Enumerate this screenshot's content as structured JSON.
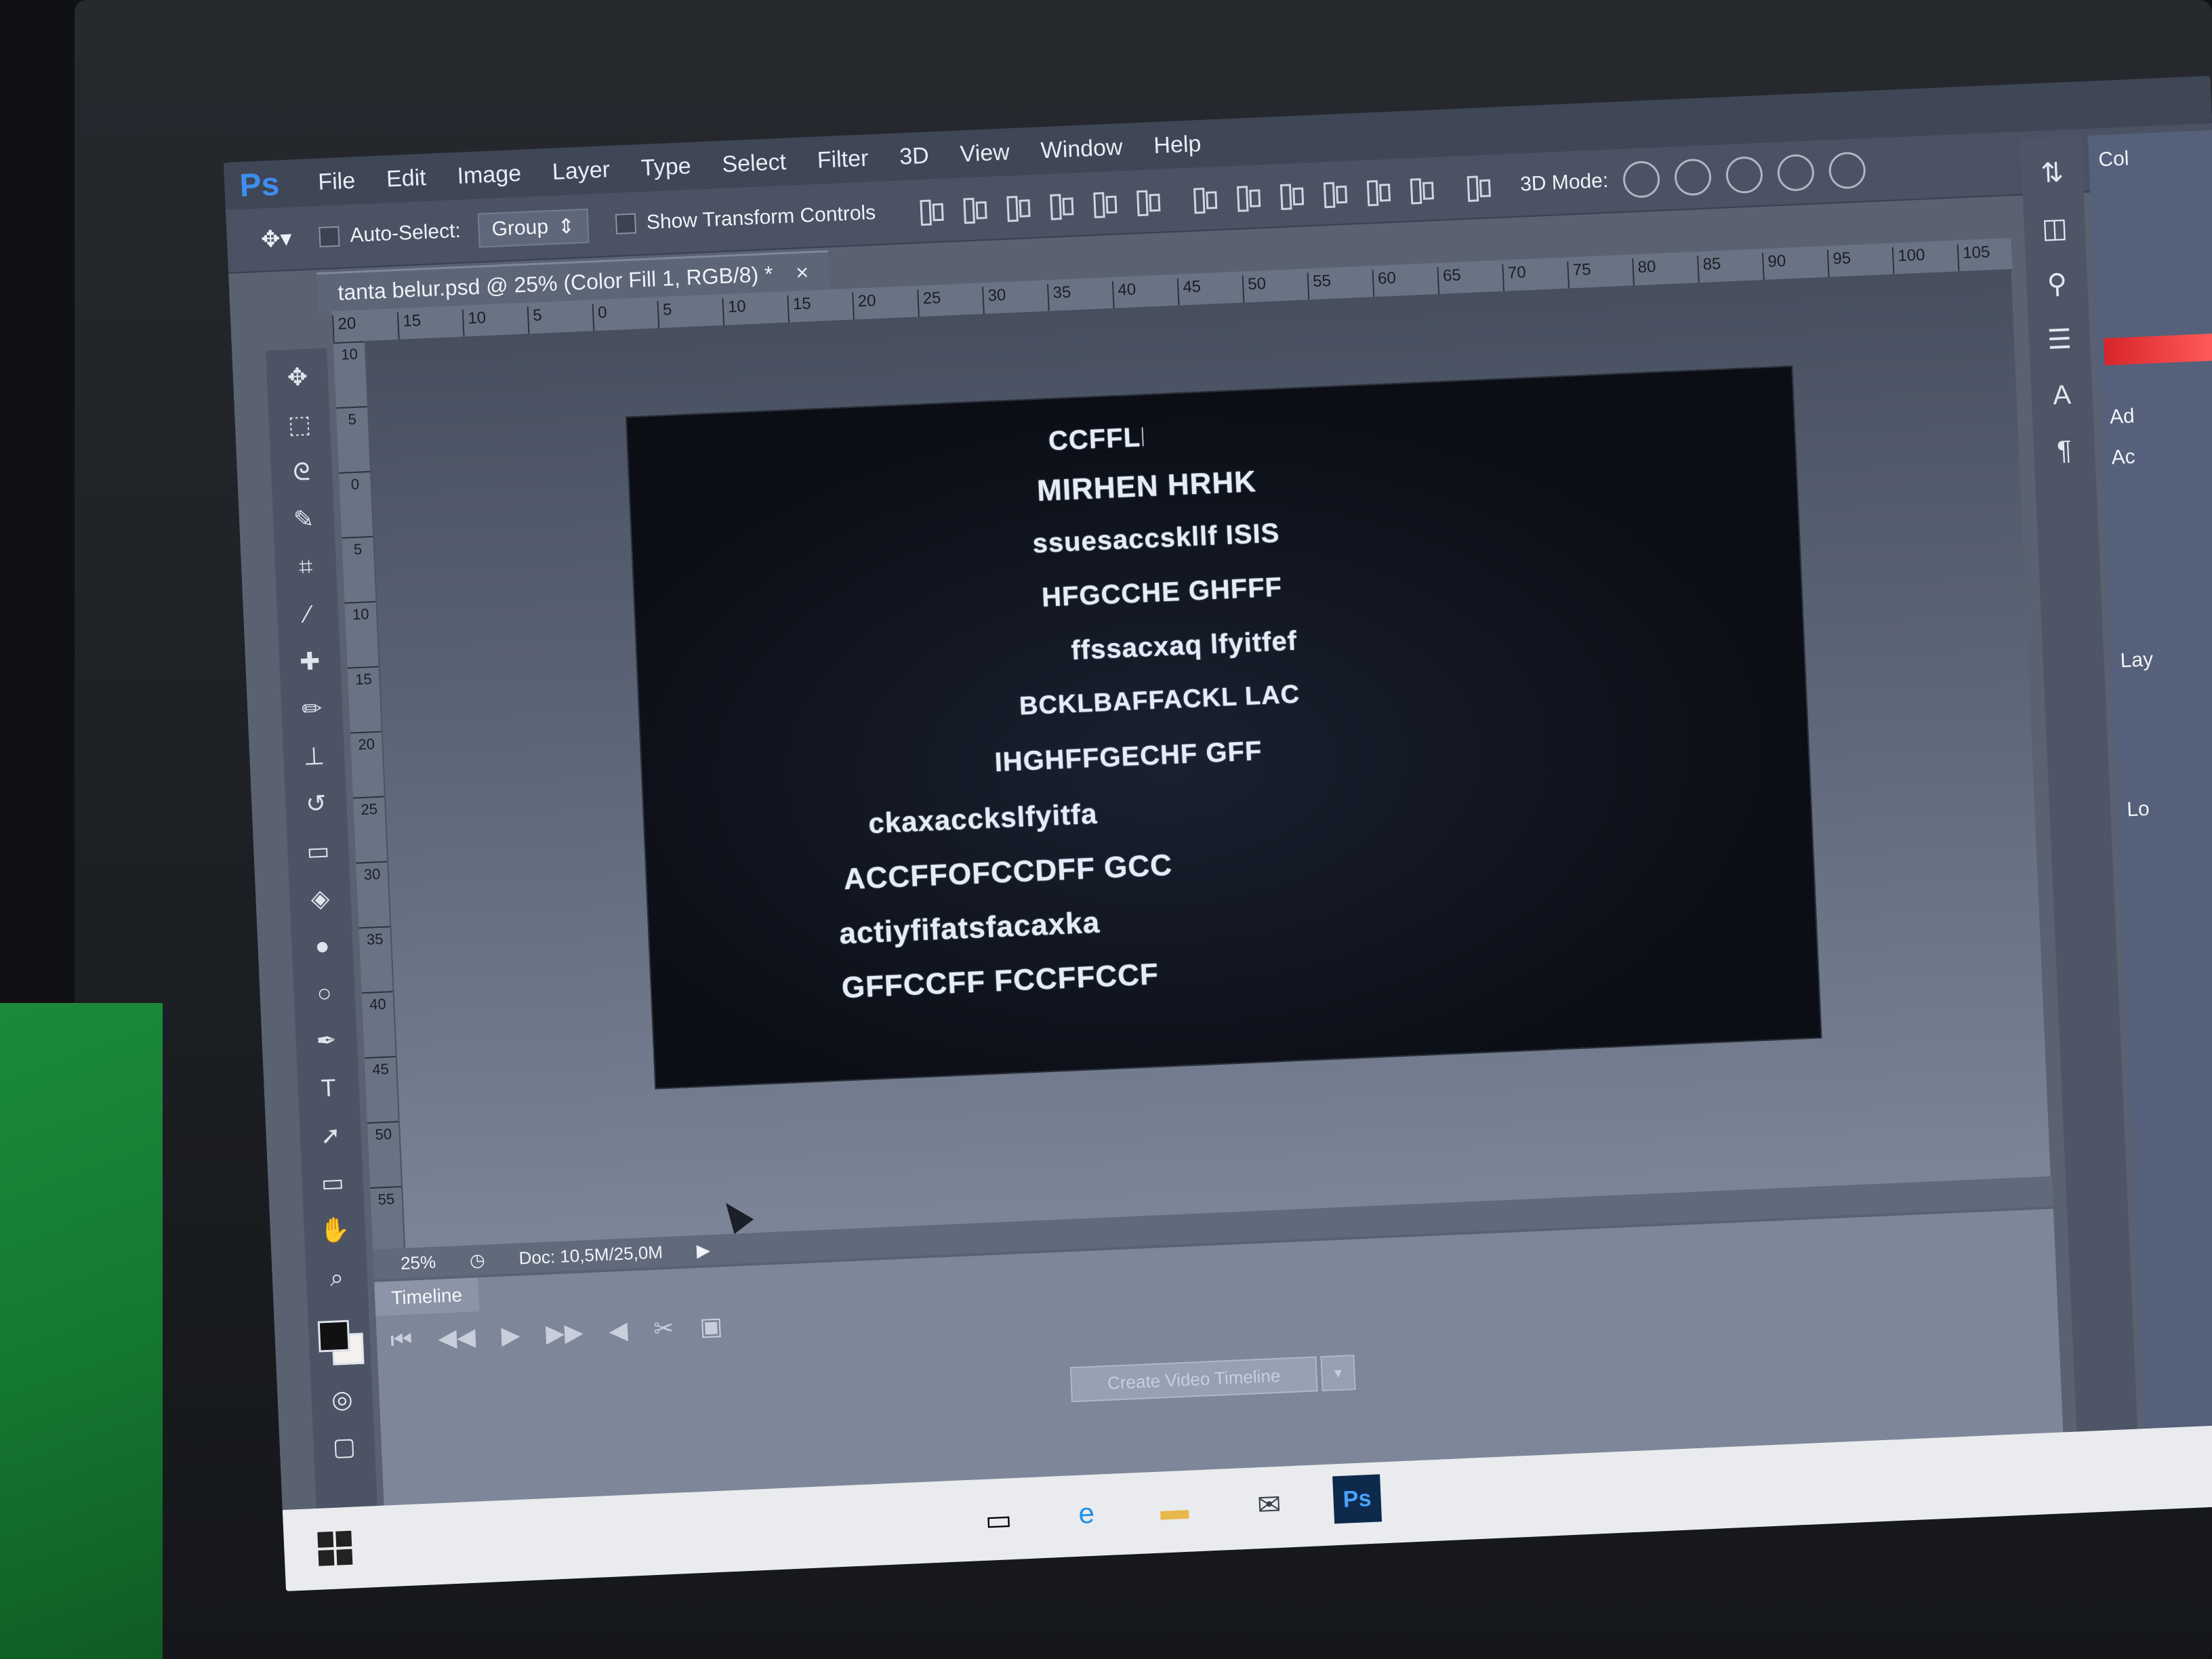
{
  "menubar": {
    "logo": "Ps",
    "items": [
      "File",
      "Edit",
      "Image",
      "Layer",
      "Type",
      "Select",
      "Filter",
      "3D",
      "View",
      "Window",
      "Help"
    ]
  },
  "options": {
    "auto_select_label": "Auto-Select:",
    "group_value": "Group",
    "show_transform_label": "Show Transform Controls",
    "mode3d_label": "3D Mode:"
  },
  "document": {
    "tab_title": "tanta belur.psd @ 25% (Color Fill 1, RGB/8) *",
    "close_glyph": "×"
  },
  "ruler_top": {
    "labels": [
      "20",
      "15",
      "10",
      "5",
      "0",
      "5",
      "10",
      "15",
      "20",
      "25",
      "30",
      "35",
      "40",
      "45",
      "50",
      "55",
      "60",
      "65",
      "70",
      "75",
      "80",
      "85",
      "90",
      "95",
      "100",
      "105"
    ]
  },
  "ruler_left": {
    "labels": [
      "10",
      "5",
      "0",
      "5",
      "10",
      "15",
      "20",
      "25",
      "30",
      "35",
      "40",
      "45",
      "50",
      "55"
    ]
  },
  "artwork": {
    "bands": [
      "CCFFLH HIENLIS",
      "MIRHEN  HRHK",
      "ssuesaccskllf ISIS",
      "HFGCCHE  GHFFF",
      "ffssacxaq lfyitfef",
      "BCKLBAFFACKL  LAC",
      "IHGHFFGECHF GFF",
      "ckaxacckslfyitfa",
      "ACCFFOFCCDFF GCC",
      "actiyfifatsfacaxka",
      "GFFCCFF  FCCFFCCF"
    ]
  },
  "status": {
    "zoom": "25%",
    "doc_info": "Doc: 10,5M/25,0M"
  },
  "timeline": {
    "tab_label": "Timeline",
    "create_button": "Create Video Timeline",
    "controls": [
      "⏮",
      "◀◀",
      "▶",
      "▶▶",
      "◀",
      "✂",
      "▣"
    ]
  },
  "right_panel": {
    "labels": [
      "Col",
      "Ad",
      "Ac",
      "Lay",
      "Lo"
    ]
  },
  "icons": {
    "tools": [
      "move-tool-icon",
      "marquee-tool-icon",
      "lasso-tool-icon",
      "quick-select-tool-icon",
      "crop-tool-icon",
      "eyedropper-tool-icon",
      "healing-brush-icon",
      "brush-tool-icon",
      "clone-stamp-icon",
      "history-brush-icon",
      "eraser-tool-icon",
      "paint-bucket-icon",
      "blur-tool-icon",
      "dodge-tool-icon",
      "pen-tool-icon",
      "type-tool-icon",
      "path-select-icon",
      "rectangle-tool-icon",
      "hand-tool-icon",
      "zoom-tool-icon"
    ],
    "dock": [
      "history-panel-icon",
      "3d-panel-icon",
      "brush-presets-icon",
      "properties-icon",
      "character-panel-icon",
      "paragraph-panel-icon"
    ]
  },
  "colors": {
    "brand_blue": "#3d8ef0",
    "foreground": "#111111",
    "background": "#f4f1ef",
    "color_bar_red": "#d8242a"
  }
}
